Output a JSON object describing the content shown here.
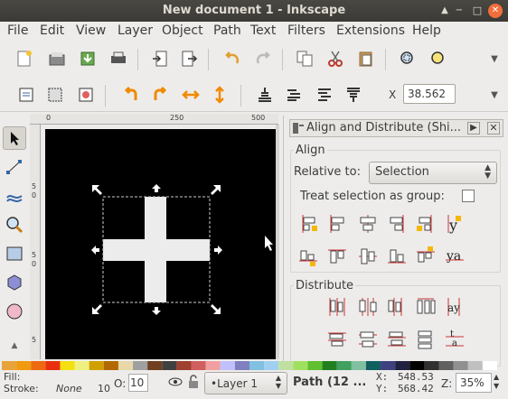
{
  "window": {
    "title": "New document 1 - Inkscape"
  },
  "menu": [
    "File",
    "Edit",
    "View",
    "Layer",
    "Object",
    "Path",
    "Text",
    "Filters",
    "Extensions",
    "Help"
  ],
  "toolbar": {
    "x_label": "X",
    "x_value": "38.562"
  },
  "ruler": {
    "top_labels": [
      "0",
      "250",
      "500"
    ],
    "left_labels": [
      "5",
      "0",
      "5",
      "0",
      "5"
    ]
  },
  "panel": {
    "title": "Align and Distribute (Shi...",
    "align_heading": "Align",
    "relative_label": "Relative to:",
    "relative_value": "Selection",
    "group_label": "Treat selection as group:",
    "distribute_heading": "Distribute"
  },
  "status": {
    "fill_label": "Fill:",
    "stroke_label": "Stroke:",
    "stroke_value": "None",
    "stroke_width": "10",
    "opacity_label": "O:",
    "opacity_value": "10",
    "layer": "•Layer 1",
    "path_info": "Path (12 ...",
    "x_label": "X:",
    "x_value": "548.53",
    "y_label": "Y:",
    "y_value": "568.42",
    "zoom_label": "Z:",
    "zoom_value": "35%"
  },
  "colors": {
    "accent": "#f5a300",
    "canvas": "#000000",
    "shape": "#ececec"
  },
  "palette": [
    "#e8a33a",
    "#f09a10",
    "#ee6a10",
    "#e83010",
    "#f4e010",
    "#f0f080",
    "#d0a000",
    "#b26a00",
    "#e8d8a8",
    "#a0a0a0",
    "#704020",
    "#404040",
    "#a04030",
    "#d06060",
    "#f0a0a0",
    "#c0c0ff",
    "#8080c0",
    "#80c0e0",
    "#a0d0f0",
    "#c0e0a0",
    "#a0e060",
    "#60c030",
    "#208020",
    "#40a060",
    "#80c0a0",
    "#106060",
    "#404080",
    "#202040",
    "#000000",
    "#303030",
    "#606060",
    "#909090",
    "#c0c0c0",
    "#ffffff"
  ]
}
